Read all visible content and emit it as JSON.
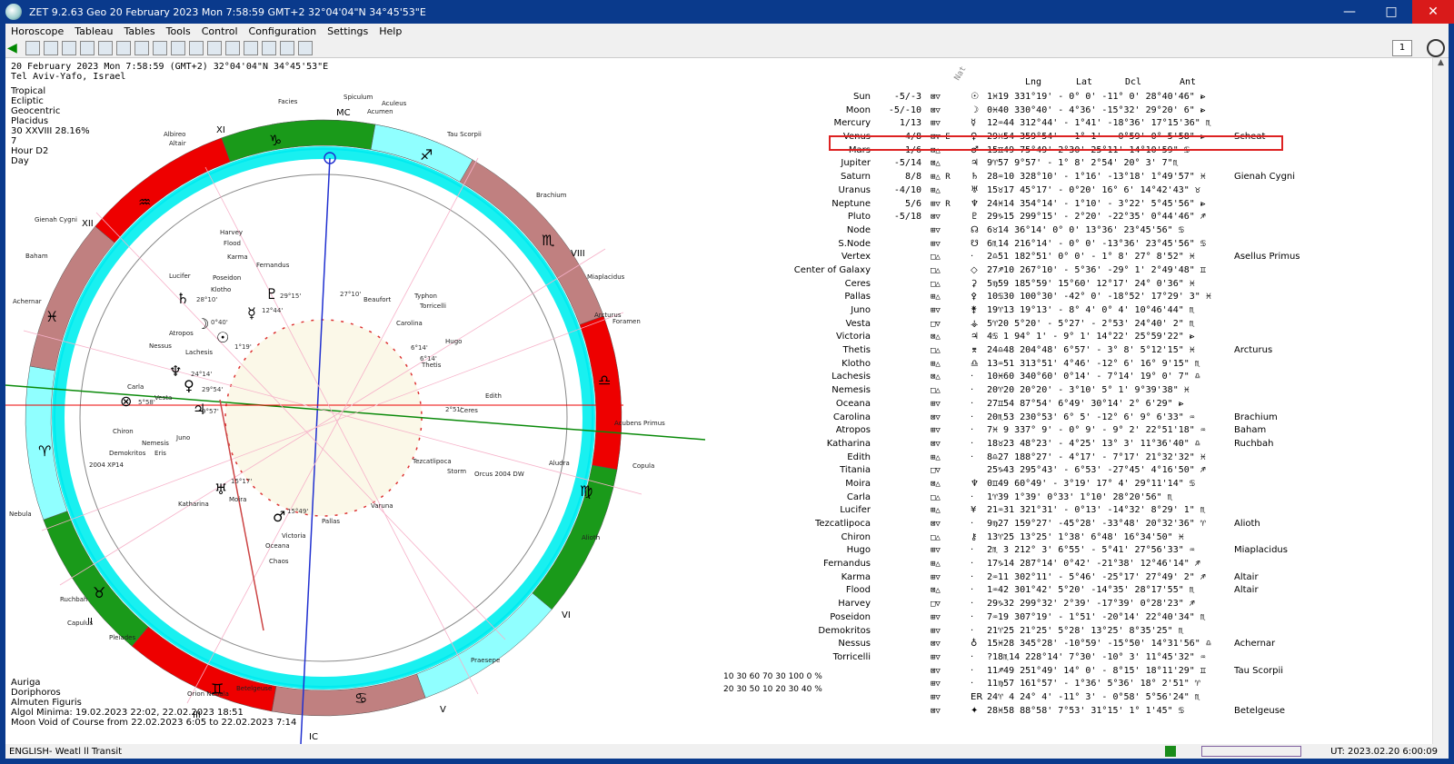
{
  "window": {
    "title": "ZET 9.2.63 Geo   20 February 2023  Mon    7:58:59 GMT+2 32°04'04\"N  34°45'53\"E",
    "minimize": "—",
    "maximize": "□",
    "close": "✕"
  },
  "menu": [
    "Horoscope",
    "Tableau",
    "Tables",
    "Tools",
    "Control",
    "Configuration",
    "Settings",
    "Help"
  ],
  "toolbar": {
    "spin_value": "1"
  },
  "header": {
    "line1": "20 February 2023  Mon   7:58:59 (GMT+2) 32°04'04\"N  34°45'53\"E",
    "line2": "Tel Aviv-Yafo, Israel"
  },
  "sysinfo": [
    "Tropical",
    "Ecliptic",
    "Geocentric",
    "Placidus",
    "30 XXVIII  28.16%",
    "7",
    "Hour D2",
    "Day"
  ],
  "bottom_info": [
    "Auriga",
    "Doriphoros",
    "Almuten Figuris",
    "Algol Minima: 19.02.2023 22:02,  22.02.2023 18:51",
    "Moon Void of Course from 22.02.2023  6:05 to 22.02.2023  7:14"
  ],
  "chart": {
    "mc_label": "MC",
    "ic_label": "IC",
    "houses": [
      "XI",
      "XII",
      "VIII",
      "VI",
      "V",
      "III",
      "II"
    ],
    "inner_marks": [
      "27°10'",
      "29°15'",
      "12°44'",
      "28°10'",
      "0°40'",
      "1°19'",
      "24°14'",
      "29°54'",
      "9°57'",
      "5°58'",
      "6°14'",
      "15°17'",
      "15°49'",
      "2°51'",
      "6°14'"
    ],
    "labels": [
      "Facies",
      "Spiculum",
      "Aculeus",
      "Acumen",
      "Albireo",
      "Altair",
      "Tau Scorpii",
      "Brachium",
      "Gienah Cygni",
      "Baham",
      "Achernar",
      "Miaplacidus",
      "Arcturus",
      "Foramen",
      "Copula",
      "Nebula",
      "Ruchbah",
      "Capulus",
      "Pleiades",
      "Orion Nebula",
      "Betelgeuse",
      "Praesepe",
      "Aludra",
      "Alioth",
      "Harvey",
      "Flood",
      "Karma",
      "Fernandus",
      "Lucifer",
      "Poseidon",
      "Klotho",
      "Atropos",
      "Nessus",
      "Lachesis",
      "Beaufort",
      "Typhon",
      "Torricelli",
      "Carolina",
      "Hugo",
      "Thetis",
      "Edith",
      "Ceres",
      "Carla",
      "Vesta",
      "Chiron",
      "Juno",
      "Nemesis",
      "Demokritos",
      "Eris",
      "2004 XP14",
      "Katharina",
      "Moira",
      "Victoria",
      "Oceana",
      "Chaos",
      "Pallas",
      "Varuna",
      "Tezcatlipoca",
      "Storm",
      "Orcus 2004 DW",
      "Acubens Primus"
    ]
  },
  "table": {
    "headers": {
      "nat": "Nat",
      "lng": "Lng",
      "lat": "Lat",
      "dcl": "Dcl",
      "ant": "Ant"
    },
    "rows": [
      {
        "name": "Sun",
        "dig": "-5/-3",
        "flags": "⊠▽",
        "glyph": "☉",
        "data": " 1♓19 331°19'  - 0° 0' -11° 0' 28°40'46\" ⩺",
        "star": ""
      },
      {
        "name": "Moon",
        "dig": "-5/-10",
        "flags": "⊠▽",
        "glyph": "☽",
        "data": " 0♓40 330°40'  - 4°36' -15°32' 29°20' 6\" ⩺",
        "star": ""
      },
      {
        "name": "Mercury",
        "dig": "1/13",
        "flags": "⊞▽",
        "glyph": "☿",
        "data": "12♒44 312°44'  - 1°41' -18°36' 17°15'36\" ♏",
        "star": ""
      },
      {
        "name": "Venus",
        "dig": "4/8",
        "flags": "⊠▽ E",
        "glyph": "♀",
        "data": "29♓54 359°54'  - 1° 1'  - 0°59'  0° 5'58\" ⩺",
        "star": "Scheat"
      },
      {
        "name": "Mars",
        "dig": "1/6",
        "flags": "⊠△",
        "glyph": "♂",
        "data": "15♊49  75°49'    2°30'  25°11' 14°10'59\" ♋",
        "star": ""
      },
      {
        "name": "Jupiter",
        "dig": "-5/14",
        "flags": "⊠△",
        "glyph": "♃",
        "data": " 9♈57   9°57'  - 1° 8'   2°54' 20° 3' 7\"♏",
        "star": ""
      },
      {
        "name": "Saturn",
        "dig": "8/8",
        "flags": "⊞△ R",
        "glyph": "♄",
        "data": "28♒10 328°10'  - 1°16' -13°18'  1°49'57\" ♓",
        "star": "Gienah Cygni"
      },
      {
        "name": "Uranus",
        "dig": "-4/10",
        "flags": "⊞△",
        "glyph": "♅",
        "data": "15♉17  45°17'  - 0°20'  16° 6' 14°42'43\" ♉",
        "star": ""
      },
      {
        "name": "Neptune",
        "dig": "5/6",
        "flags": "⊞▽ R",
        "glyph": "♆",
        "data": "24♓14 354°14'  - 1°10'  - 3°22'  5°45'56\" ⩺",
        "star": ""
      },
      {
        "name": "Pluto",
        "dig": "-5/18",
        "flags": "⊠▽",
        "glyph": "♇",
        "data": "29♑15 299°15'  - 2°20' -22°35'  0°44'46\" ♐",
        "star": ""
      },
      {
        "name": "Node",
        "dig": "",
        "flags": "⊞▽",
        "glyph": "☊",
        "data": " 6♉14  36°14'    0° 0'  13°36' 23°45'56\" ♋",
        "star": ""
      },
      {
        "name": "S.Node",
        "dig": "",
        "flags": "⊞▽",
        "glyph": "☋",
        "data": " 6♏14 216°14'  - 0° 0' -13°36' 23°45'56\" ♋",
        "star": ""
      },
      {
        "name": "Vertex",
        "dig": "",
        "flags": "□△",
        "glyph": "·",
        "data": " 2♎51 182°51'    0° 0'  - 1° 8' 27° 8'52\" ♓",
        "star": "Asellus Primus"
      },
      {
        "name": "Center of Galaxy",
        "dig": "",
        "flags": "□△",
        "glyph": "◇",
        "data": "27♐10 267°10'  - 5°36' -29° 1'  2°49'48\" ♊",
        "star": ""
      },
      {
        "name": "Ceres",
        "dig": "",
        "flags": "□△",
        "glyph": "⚳",
        "data": " 5♍59 185°59'  15°60'  12°17' 24° 0'36\" ♓",
        "star": ""
      },
      {
        "name": "Pallas",
        "dig": "",
        "flags": "⊞△",
        "glyph": "⚴",
        "data": "10♋30 100°30' -42° 0' -18°52' 17°29' 3\" ♓",
        "star": ""
      },
      {
        "name": "Juno",
        "dig": "",
        "flags": "⊞▽",
        "glyph": "⚵",
        "data": "19♈13  19°13'  - 8° 4'    0° 4' 10°46'44\" ♏",
        "star": ""
      },
      {
        "name": "Vesta",
        "dig": "",
        "flags": "□▽",
        "glyph": "⚶",
        "data": " 5♈20   5°20'  - 5°27'  - 2°53' 24°40' 2\" ♏",
        "star": ""
      },
      {
        "name": "Victoria",
        "dig": "",
        "flags": "⊠△",
        "glyph": "♃",
        "data": " 4♋ 1  94° 1'  - 9° 1'  14°22' 25°59'22\" ⩺",
        "star": ""
      },
      {
        "name": "Thetis",
        "dig": "",
        "flags": "□△",
        "glyph": "⌆",
        "data": "24♎48 204°48'    6°57'  - 3° 8'  5°12'15\" ♓",
        "star": "Arcturus"
      },
      {
        "name": "Klotho",
        "dig": "",
        "flags": "⊞△",
        "glyph": "♎",
        "data": "13♒51 313°51'    4°46' -12° 6' 16° 9'15\" ♏",
        "star": ""
      },
      {
        "name": "Lachesis",
        "dig": "",
        "flags": "⊠△",
        "glyph": "·",
        "data": "10♓60 340°60'    0°14'  - 7°14' 19° 0' 7\" ♎",
        "star": ""
      },
      {
        "name": "Nemesis",
        "dig": "",
        "flags": "□△",
        "glyph": "·",
        "data": "20♈20  20°20'  - 3°10'    5° 1'  9°39'38\" ♓",
        "star": ""
      },
      {
        "name": "Oceana",
        "dig": "",
        "flags": "⊞▽",
        "glyph": "·",
        "data": "27♊54  87°54'    6°49'  30°14'  2° 6'29\" ⩺",
        "star": ""
      },
      {
        "name": "Carolina",
        "dig": "",
        "flags": "⊠▽",
        "glyph": "·",
        "data": "20♏53 230°53'    6° 5' -12° 6'  9° 6'33\" ♒",
        "star": "Brachium"
      },
      {
        "name": "Atropos",
        "dig": "",
        "flags": "⊞▽",
        "glyph": "·",
        "data": " 7♓ 9 337° 9'  - 0° 9'  - 9° 2' 22°51'18\" ♒",
        "star": "Baham"
      },
      {
        "name": "Katharina",
        "dig": "",
        "flags": "⊠▽",
        "glyph": "·",
        "data": "18♉23  48°23'  - 4°25'  13° 3' 11°36'40\" ♎",
        "star": "Ruchbah"
      },
      {
        "name": "Edith",
        "dig": "",
        "flags": "⊞△",
        "glyph": "·",
        "data": " 8♎27 188°27'  - 4°17'  - 7°17' 21°32'32\" ♓",
        "star": ""
      },
      {
        "name": "Titania",
        "dig": "",
        "flags": "□▽",
        "glyph": "",
        "data": "25♑43 295°43'  - 6°53' -27°45'  4°16'50\" ♐",
        "star": ""
      },
      {
        "name": "Moira",
        "dig": "",
        "flags": "⊠△",
        "glyph": "♆",
        "data": " 0♊49  60°49'  - 3°19'  17° 4' 29°11'14\" ♋",
        "star": ""
      },
      {
        "name": "Carla",
        "dig": "",
        "flags": "□△",
        "glyph": "·",
        "data": " 1♈39   1°39'    0°33'   1°10' 28°20'56\" ♏",
        "star": ""
      },
      {
        "name": "Lucifer",
        "dig": "",
        "flags": "⊞△",
        "glyph": "¥",
        "data": "21♒31 321°31'  - 0°13' -14°32'  8°29' 1\" ♏",
        "star": ""
      },
      {
        "name": "Tezcatlipoca",
        "dig": "",
        "flags": "⊠▽",
        "glyph": "·",
        "data": " 9♍27 159°27' -45°28' -33°48' 20°32'36\" ♈",
        "star": "Alioth"
      },
      {
        "name": "Chiron",
        "dig": "",
        "flags": "□△",
        "glyph": "⚷",
        "data": "13♈25  13°25'    1°38'   6°48' 16°34'50\" ♓",
        "star": ""
      },
      {
        "name": "Hugo",
        "dig": "",
        "flags": "⊞▽",
        "glyph": "·",
        "data": " 2♏ 3 212° 3'    6°55'  - 5°41' 27°56'33\" ♒",
        "star": "Miaplacidus"
      },
      {
        "name": "Fernandus",
        "dig": "",
        "flags": "⊞△",
        "glyph": "·",
        "data": "17♑14 287°14'    0°42' -21°38' 12°46'14\" ♐",
        "star": ""
      },
      {
        "name": "Karma",
        "dig": "",
        "flags": "⊞▽",
        "glyph": "·",
        "data": " 2♒11 302°11'  - 5°46' -25°17' 27°49' 2\" ♐",
        "star": "Altair"
      },
      {
        "name": "Flood",
        "dig": "",
        "flags": "⊠△",
        "glyph": "·",
        "data": " 1♒42 301°42'    5°20' -14°35' 28°17'55\" ♏",
        "star": "Altair"
      },
      {
        "name": "Harvey",
        "dig": "",
        "flags": "□▽",
        "glyph": "·",
        "data": "29♑32 299°32'    2°39' -17°39'  0°28'23\" ♐",
        "star": ""
      },
      {
        "name": "Poseidon",
        "dig": "",
        "flags": "⊞▽",
        "glyph": "·",
        "data": " 7♒19 307°19'  - 1°51' -20°14' 22°40'34\" ♏",
        "star": ""
      },
      {
        "name": "Demokritos",
        "dig": "",
        "flags": "⊞▽",
        "glyph": "·",
        "data": "21♈25  21°25'    5°28'  13°25'  8°35'25\" ♏",
        "star": ""
      },
      {
        "name": "Nessus",
        "dig": "",
        "flags": "⊠▽",
        "glyph": "♁",
        "data": "15♓28 345°28' -10°59' -15°50' 14°31'56\" ♎",
        "star": "Achernar"
      },
      {
        "name": "Torricelli",
        "dig": "",
        "flags": "⊞▽",
        "glyph": "·",
        "data": "?18♏14 228°14'    7°30' -10° 3' 11°45'32\" ♒",
        "star": ""
      },
      {
        "name": "",
        "dig": "",
        "flags": "⊠▽",
        "glyph": "·",
        "data": "11♐49 251°49'   14° 0'  - 8°15' 18°11'29\" ♊",
        "star": "Tau Scorpii"
      },
      {
        "name": "",
        "dig": "",
        "flags": "⊞▽",
        "glyph": "·",
        "data": "11♍57 161°57'  - 1°36'   5°36' 18° 2'51\" ♈",
        "star": ""
      },
      {
        "name": "",
        "dig": "",
        "flags": "⊞▽",
        "glyph": "ER",
        "data": "24♈ 4  24° 4' -11° 3'  - 0°58'  5°56'24\" ♏",
        "star": ""
      },
      {
        "name": "",
        "dig": "",
        "flags": "⊠▽",
        "glyph": "✦",
        "data": "28♓58 88°58'    7°53'  31°15'  1° 1'45\" ♋",
        "star": "Betelgeuse"
      }
    ]
  },
  "legend": [
    "10  30  60      70  30  100 0 %",
    "20  30  50      10  20  30  40 %"
  ],
  "status": {
    "left": "ENGLISH- Weatl ll Transit",
    "right": "UT: 2023.02.20  6:00:09"
  }
}
